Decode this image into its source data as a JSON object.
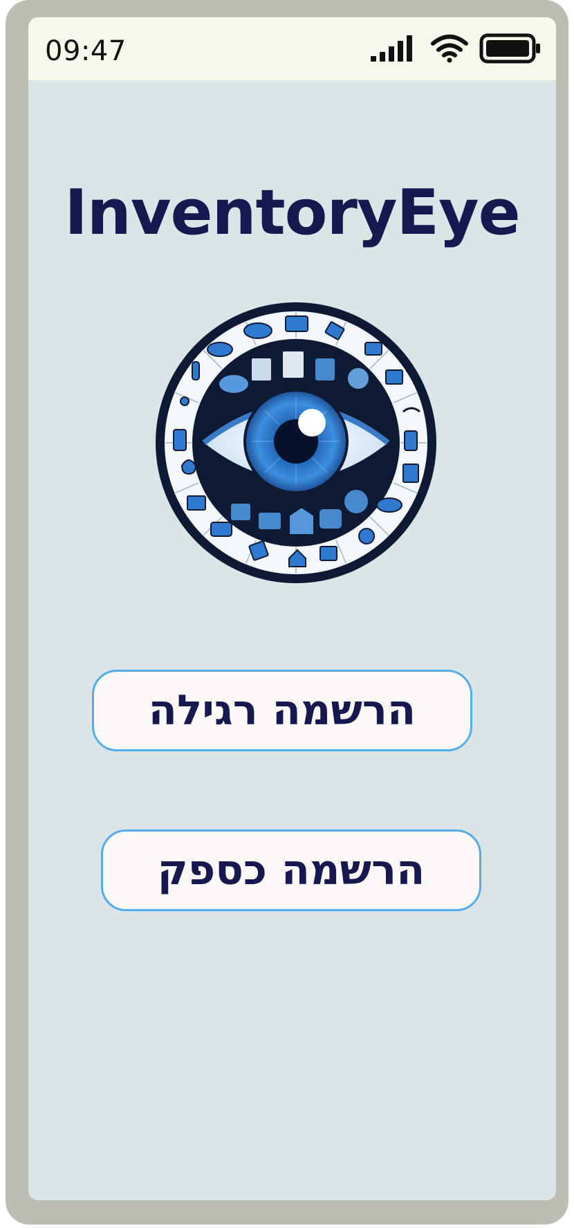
{
  "status_bar": {
    "time": "09:47",
    "icons": [
      "signal-icon",
      "wifi-icon",
      "battery-icon"
    ]
  },
  "app": {
    "title": "InventoryEye",
    "logo_icon": "eye-logo-icon"
  },
  "buttons": {
    "regular_signup": "הרשמה רגילה",
    "supplier_signup": "הרשמה כספק"
  },
  "colors": {
    "screen_bg": "#dbe4e7",
    "status_bg": "#f7f7ec",
    "title": "#17184f",
    "button_border": "#53acec",
    "button_bg": "#fbf8f7",
    "frame": "#bebdb4"
  }
}
